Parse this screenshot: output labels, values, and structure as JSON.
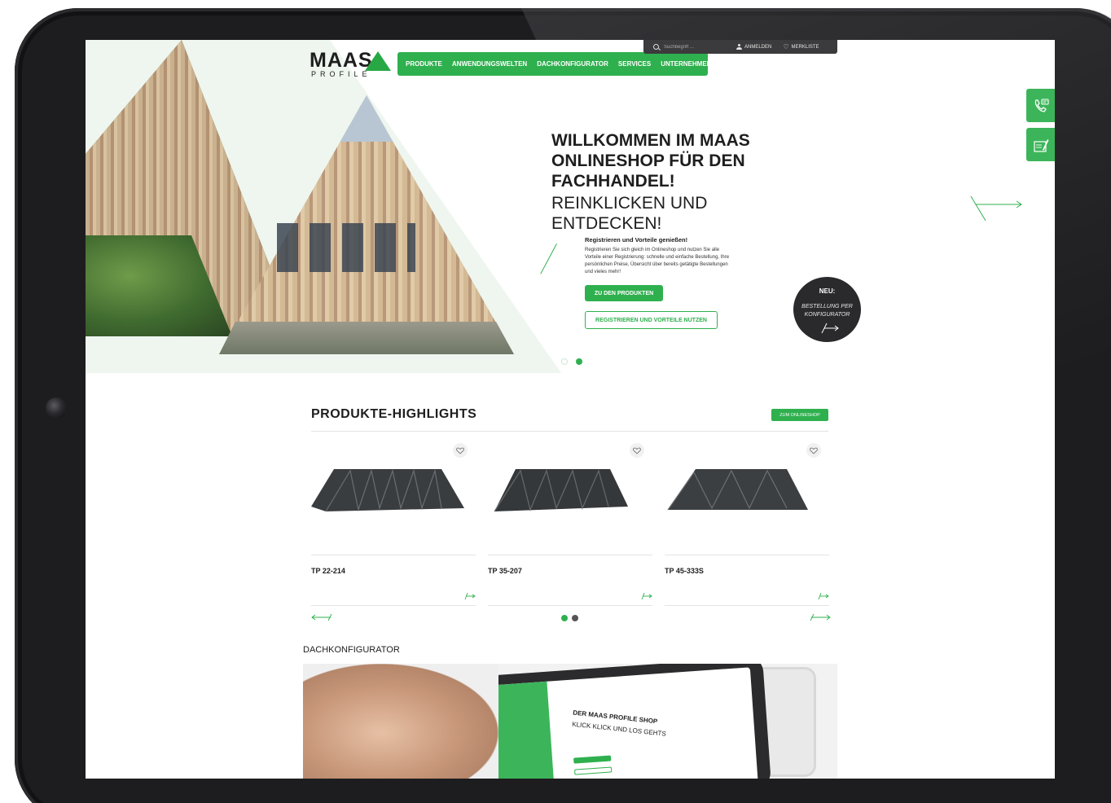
{
  "colors": {
    "brand_green": "#2fb04e",
    "dark": "#2a2a2c",
    "hero_bg": "#eef6ef"
  },
  "logo": {
    "name": "MAAS",
    "sub": "PROFILE"
  },
  "topbar": {
    "search_placeholder": "Suchbegriff ...",
    "login": "ANMELDEN",
    "wishlist": "MERKLISTE"
  },
  "nav": {
    "items": [
      {
        "label": "PRODUKTE"
      },
      {
        "label": "ANWENDUNGSWELTEN"
      },
      {
        "label": "DACHKONFIGURATOR"
      },
      {
        "label": "SERVICES"
      },
      {
        "label": "UNTERNEHMEN"
      }
    ]
  },
  "side_tabs": [
    {
      "icon": "phone-icon"
    },
    {
      "icon": "form-icon"
    }
  ],
  "hero": {
    "title": "WILLKOMMEN IM MAAS ONLINESHOP FÜR DEN FACHHANDEL!",
    "subtitle": "REINKLICKEN UND ENTDECKEN!",
    "reg_heading": "Registrieren und Vorteile genießen!",
    "reg_text": "Registrieren Sie sich gleich im Onlineshop und nutzen Sie alle Vorteile einer Registrierung: schnelle und einfache Bestellung, Ihre persönlichen Preise, Übersicht über bereits getätigte Bestellungen und vieles mehr!",
    "btn_products": "ZU DEN PRODUKTEN",
    "btn_register": "REGISTRIEREN UND VORTEILE NUTZEN",
    "slides": 2,
    "active_slide": 2
  },
  "badge": {
    "title": "NEU:",
    "text": "BESTELLUNG PER KONFIGURATOR"
  },
  "highlights": {
    "title": "PRODUKTE-HIGHLIGHTS",
    "shop_button": "ZUM ONLINESHOP",
    "products": [
      {
        "name": "TP 22-214"
      },
      {
        "name": "TP 35-207"
      },
      {
        "name": "TP 45-333S"
      }
    ],
    "pages": 2,
    "active_page": 1
  },
  "konfigurator": {
    "title": "DACHKONFIGURATOR",
    "banner_heading": "DER MAAS PROFILE SHOP",
    "banner_sub": "KLICK KLICK UND LOS GEHTS"
  }
}
